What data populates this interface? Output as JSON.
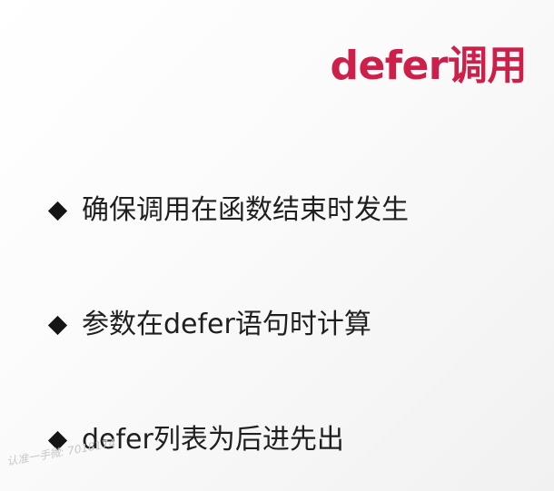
{
  "slide": {
    "title": "defer调用",
    "title_color": "#cc1f4a",
    "bullets": [
      {
        "text": "确保调用在函数结束时发生"
      },
      {
        "text": "参数在defer语句时计算"
      },
      {
        "text": "defer列表为后进先出"
      }
    ]
  },
  "watermark": {
    "text": "认准一手微: 7018174"
  }
}
